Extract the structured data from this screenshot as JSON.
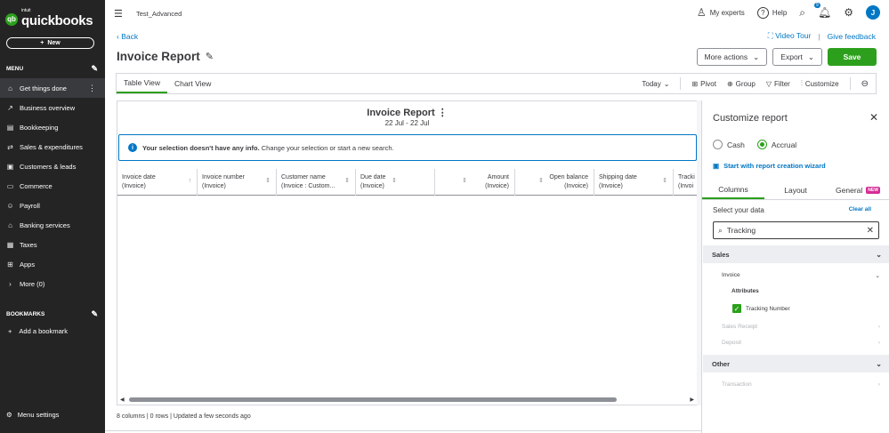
{
  "sidebar": {
    "logo_intuit": "intuit",
    "logo_text": "quickbooks",
    "new_label": "New",
    "menu_label": "MENU",
    "items": [
      {
        "label": "Get things done",
        "icon": "home-icon"
      },
      {
        "label": "Business overview",
        "icon": "chart-icon"
      },
      {
        "label": "Bookkeeping",
        "icon": "book-icon"
      },
      {
        "label": "Sales & expenditures",
        "icon": "sales-icon"
      },
      {
        "label": "Customers & leads",
        "icon": "customers-icon"
      },
      {
        "label": "Commerce",
        "icon": "commerce-icon"
      },
      {
        "label": "Payroll",
        "icon": "payroll-icon"
      },
      {
        "label": "Banking services",
        "icon": "bank-icon"
      },
      {
        "label": "Taxes",
        "icon": "taxes-icon"
      },
      {
        "label": "Apps",
        "icon": "apps-icon"
      },
      {
        "label": "More (0)",
        "icon": "chevron-right-icon"
      }
    ],
    "bookmarks_label": "BOOKMARKS",
    "add_bookmark": "Add a bookmark",
    "menu_settings": "Menu settings"
  },
  "topbar": {
    "company": "Test_Advanced",
    "my_experts": "My experts",
    "help": "Help",
    "notif_count": "9",
    "avatar": "J"
  },
  "header": {
    "back": "Back",
    "title": "Invoice Report",
    "video_tour": "Video Tour",
    "feedback": "Give feedback",
    "more_actions": "More actions",
    "export": "Export",
    "save": "Save"
  },
  "viewbar": {
    "tabs": [
      "Table View",
      "Chart View"
    ],
    "today": "Today",
    "pivot": "Pivot",
    "group": "Group",
    "filter": "Filter",
    "customize": "Customize"
  },
  "report": {
    "title": "Invoice Report",
    "date_range": "22 Jul - 22 Jul",
    "info_bold": "Your selection doesn't have any info.",
    "info_rest": " Change your selection or start a new search.",
    "columns": [
      {
        "name": "Invoice date",
        "sub": "(Invoice)"
      },
      {
        "name": "Invoice number",
        "sub": "(Invoice)"
      },
      {
        "name": "Customer name",
        "sub": "(Invoice : Custom..."
      },
      {
        "name": "Due date",
        "sub": "(Invoice)"
      },
      {
        "name": "Amount",
        "sub": "(Invoice)"
      },
      {
        "name": "Open balance",
        "sub": "(Invoice)"
      },
      {
        "name": "Shipping date",
        "sub": "(Invoice)"
      },
      {
        "name": "Tracki",
        "sub": "(Invoi"
      }
    ],
    "status": "8 columns | 0 rows | Updated a few seconds ago"
  },
  "panel": {
    "title": "Customize report",
    "cash": "Cash",
    "accrual": "Accrual",
    "wizard": "Start with report creation wizard",
    "tabs": [
      "Columns",
      "Layout",
      "General"
    ],
    "new_badge": "NEW",
    "select_data": "Select your data",
    "clear_all": "Clear all",
    "search_value": "Tracking",
    "group_sales": "Sales",
    "invoice": "Invoice",
    "attributes": "Attributes",
    "tracking_number": "Tracking Number",
    "sales_receipt": "Sales Receipt",
    "deposit": "Deposit",
    "group_other": "Other",
    "transaction": "Transaction"
  },
  "colors": {
    "accent": "#2ca01c",
    "link": "#0077c5",
    "sidebar": "#242424"
  }
}
